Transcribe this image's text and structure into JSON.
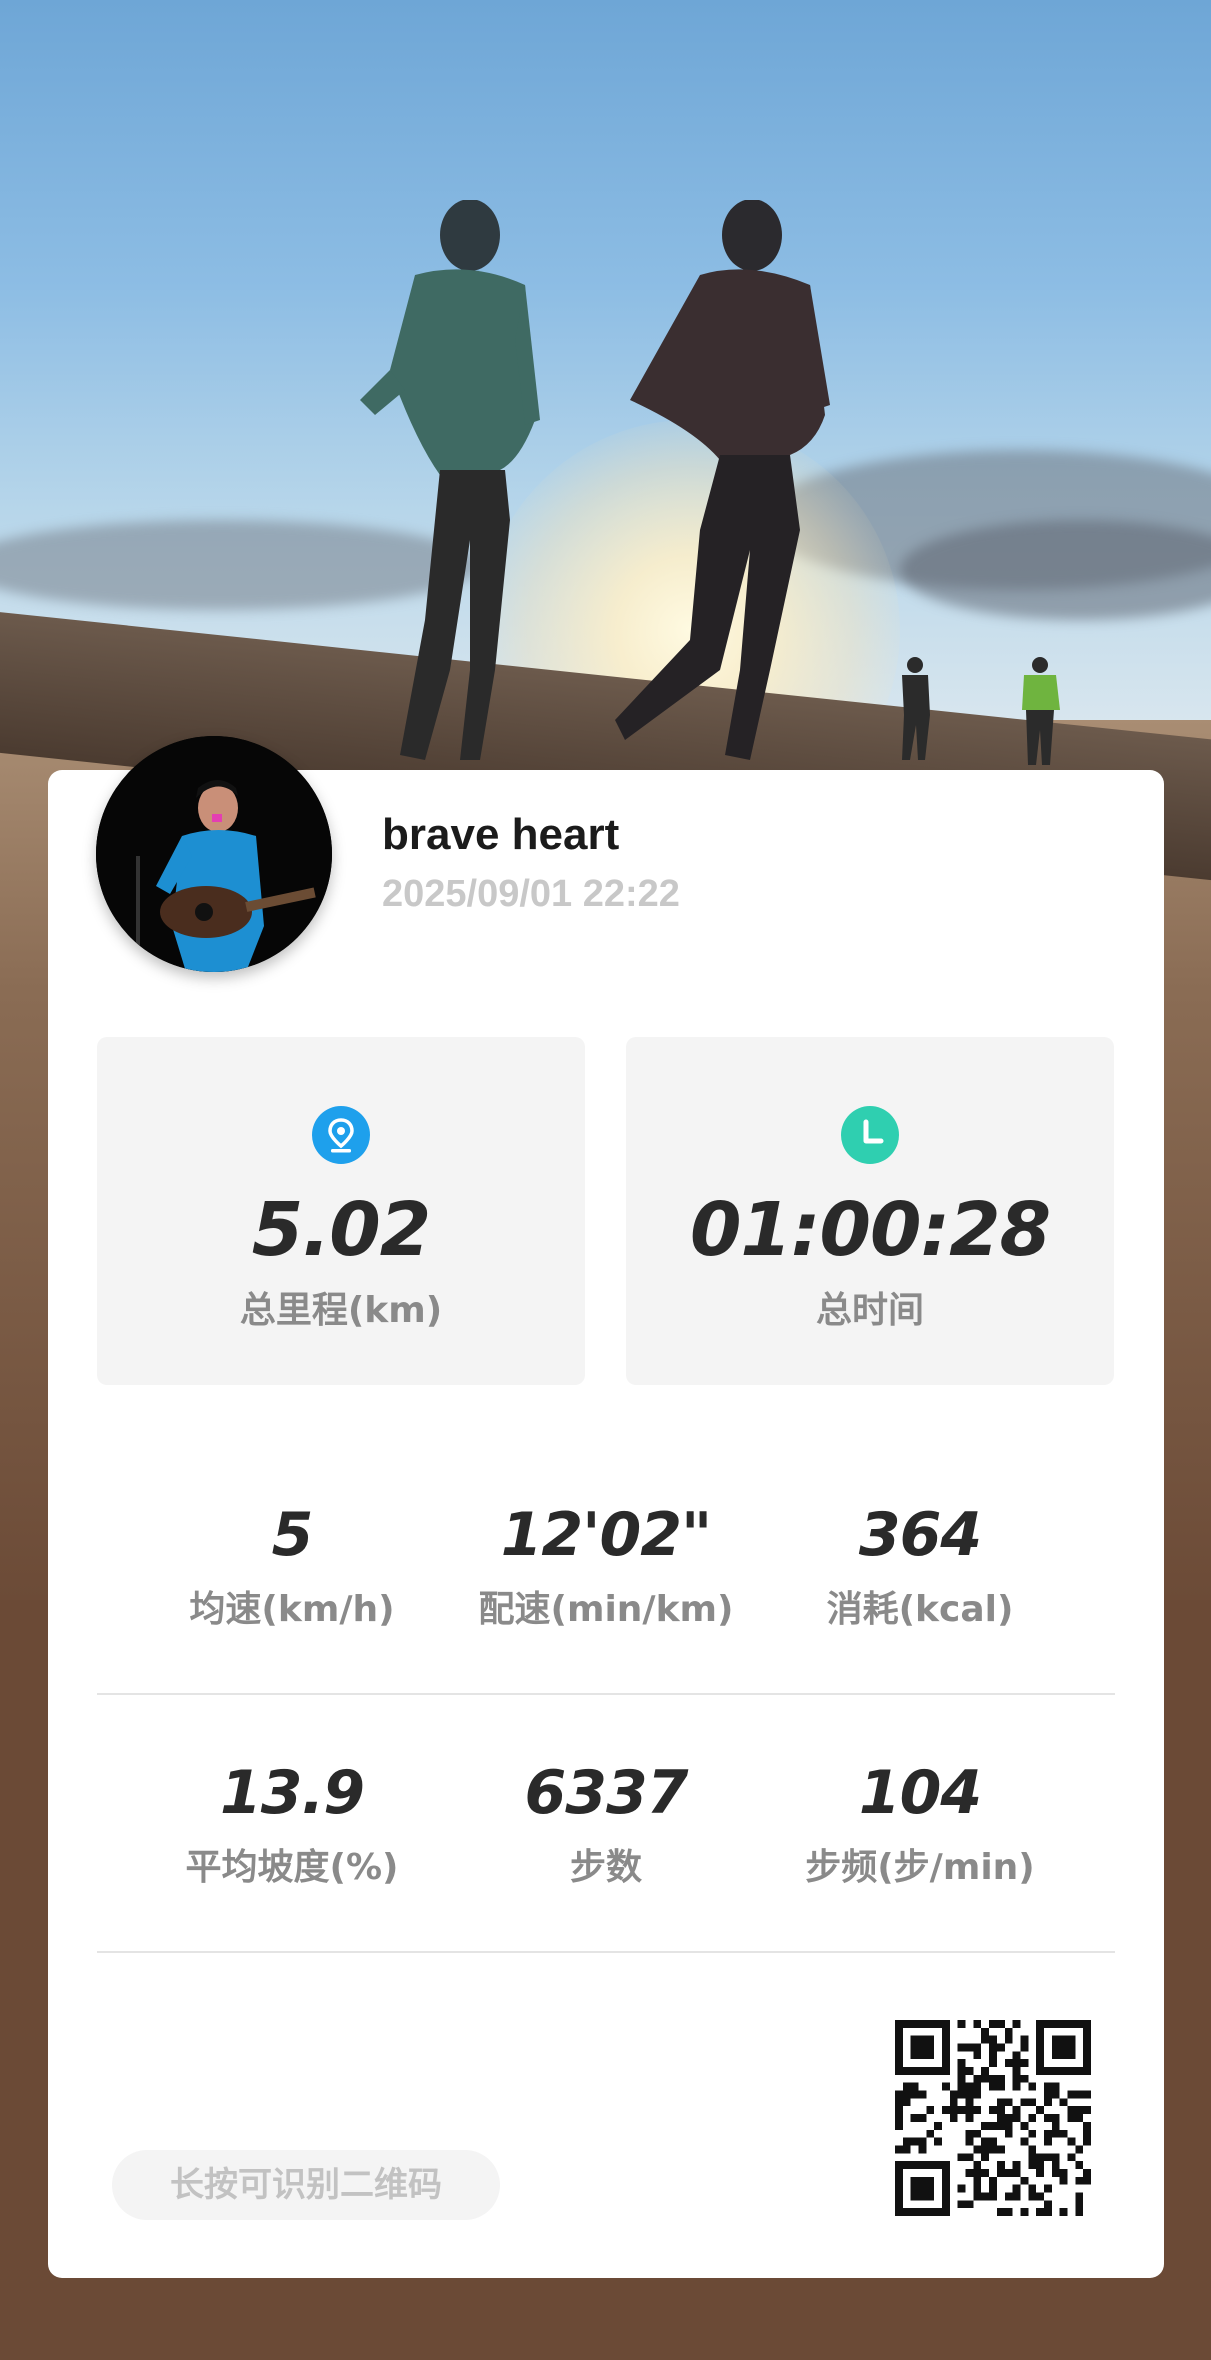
{
  "profile": {
    "username": "brave heart",
    "datetime": "2025/09/01 22:22"
  },
  "summary": {
    "distance": {
      "value": "5.02",
      "label": "总里程(km)",
      "icon": "location-pin-icon",
      "icon_color": "#1ea0ec"
    },
    "duration": {
      "value": "01:00:28",
      "label": "总时间",
      "icon": "clock-icon",
      "icon_color": "#2fcfb0"
    }
  },
  "metrics_row1": [
    {
      "value": "5",
      "label": "均速(km/h)"
    },
    {
      "value": "12'02\"",
      "label": "配速(min/km)"
    },
    {
      "value": "364",
      "label": "消耗(kcal)"
    }
  ],
  "metrics_row2": [
    {
      "value": "13.9",
      "label": "平均坡度(%)"
    },
    {
      "value": "6337",
      "label": "步数"
    },
    {
      "value": "104",
      "label": "步频(步/min)"
    }
  ],
  "footer": {
    "qr_hint": "长按可识别二维码",
    "qr_icon": "qr-code-icon"
  },
  "colors": {
    "background": "#6b4a36",
    "card": "#ffffff",
    "value_text": "#2a2a2a",
    "label_text": "#8a8a8a"
  }
}
